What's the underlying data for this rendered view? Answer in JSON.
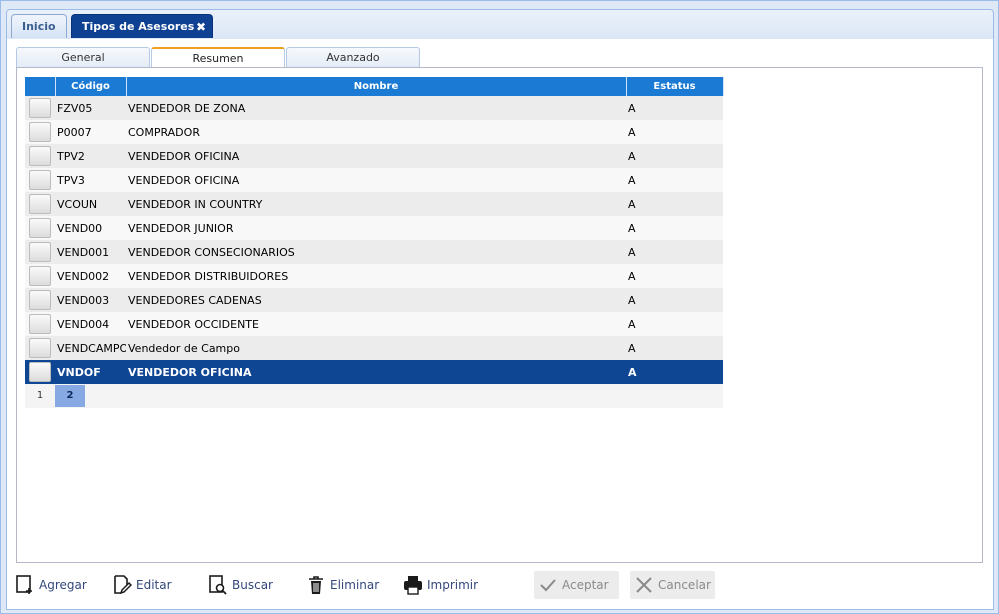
{
  "app_tabs": {
    "home": "Inicio",
    "active": "Tipos de Asesores",
    "close_glyph": "✖"
  },
  "sub_tabs": [
    "General",
    "Resumen",
    "Avanzado"
  ],
  "grid": {
    "headers": [
      "Código",
      "Nombre",
      "Estatus"
    ],
    "rows": [
      {
        "code": "FZV05",
        "name": "VENDEDOR DE ZONA",
        "status": "A"
      },
      {
        "code": "P0007",
        "name": "COMPRADOR",
        "status": "A"
      },
      {
        "code": "TPV2",
        "name": "VENDEDOR OFICINA",
        "status": "A"
      },
      {
        "code": "TPV3",
        "name": "VENDEDOR OFICINA",
        "status": "A"
      },
      {
        "code": "VCOUN",
        "name": "VENDEDOR IN COUNTRY",
        "status": "A"
      },
      {
        "code": "VEND00",
        "name": "VENDEDOR JUNIOR",
        "status": "A"
      },
      {
        "code": "VEND001",
        "name": "VENDEDOR CONSECIONARIOS",
        "status": "A"
      },
      {
        "code": "VEND002",
        "name": "VENDEDOR DISTRIBUIDORES",
        "status": "A"
      },
      {
        "code": "VEND003",
        "name": "VENDEDORES CADENAS",
        "status": "A"
      },
      {
        "code": "VEND004",
        "name": "VENDEDOR OCCIDENTE",
        "status": "A"
      },
      {
        "code": "VENDCAMPO",
        "name": "Vendedor de Campo",
        "status": "A"
      },
      {
        "code": "VNDOF",
        "name": "VENDEDOR OFICINA",
        "status": "A"
      }
    ],
    "selected_index": 11,
    "pages": [
      "1",
      "2"
    ],
    "current_page": "2"
  },
  "toolbar": {
    "add": "Agregar",
    "edit": "Editar",
    "search": "Buscar",
    "delete": "Eliminar",
    "print": "Imprimir",
    "accept": "Aceptar",
    "cancel": "Cancelar"
  },
  "colors": {
    "header": "#1b7ad3",
    "selected_row": "#0f4694",
    "active_tab": "#0e4192",
    "current_page": "#86a9e4"
  }
}
